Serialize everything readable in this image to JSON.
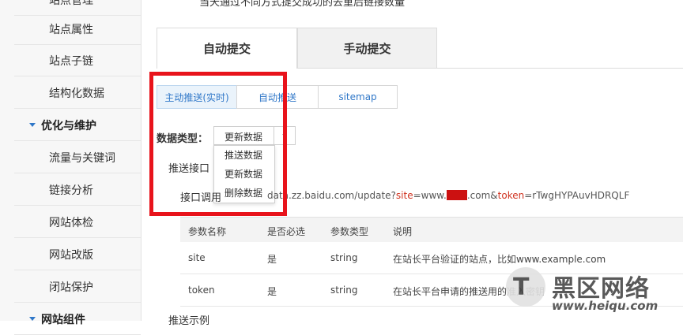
{
  "sidebar": {
    "items": [
      {
        "label": "站点属性"
      },
      {
        "label": "站点子链"
      },
      {
        "label": "结构化数据"
      },
      {
        "label": "流量与关键词"
      },
      {
        "label": "链接分析"
      },
      {
        "label": "网站体检"
      },
      {
        "label": "网站改版"
      },
      {
        "label": "闭站保护"
      }
    ],
    "sections": [
      {
        "label": "优化与维护"
      },
      {
        "label": "网站组件"
      }
    ],
    "top_partial": "站点管理"
  },
  "main": {
    "top_note": "当天通过不同方式提交成功的去重后链接数量",
    "tabs": [
      {
        "label": "自动提交",
        "active": true
      },
      {
        "label": "手动提交",
        "active": false
      }
    ],
    "subtabs": [
      {
        "label": "主动推送(实时)",
        "active": true
      },
      {
        "label": "自动推送",
        "active": false
      },
      {
        "label": "sitemap",
        "active": false
      }
    ],
    "data_type": {
      "label": "数据类型：",
      "selected": "更新数据",
      "options": [
        "推送数据",
        "更新数据",
        "删除数据"
      ]
    },
    "push_api_label": "推送接口",
    "api_call_label": "接口调用",
    "api_url": {
      "prefix": "data.zz.baidu.com/update?",
      "site_key": "site",
      "eq1": "=www.",
      "mid": ".com&",
      "token_key": "token",
      "token_value": "=rTwgHYPAuvHDRQLF"
    },
    "table": {
      "headers": [
        "参数名称",
        "是否必选",
        "参数类型",
        "说明"
      ],
      "rows": [
        [
          "site",
          "是",
          "string",
          "在站长平台验证的站点，比如www.example.com"
        ],
        [
          "token",
          "是",
          "string",
          "在站长平台申请的推送用的准入密钥"
        ]
      ]
    },
    "bottom_note": "推送示例"
  },
  "watermark": {
    "cn": "黑区网络",
    "url": "www.heiqu.com"
  },
  "colors": {
    "accent": "#2f77c8",
    "highlight": "#e8131b",
    "mask": "#cc1111"
  }
}
